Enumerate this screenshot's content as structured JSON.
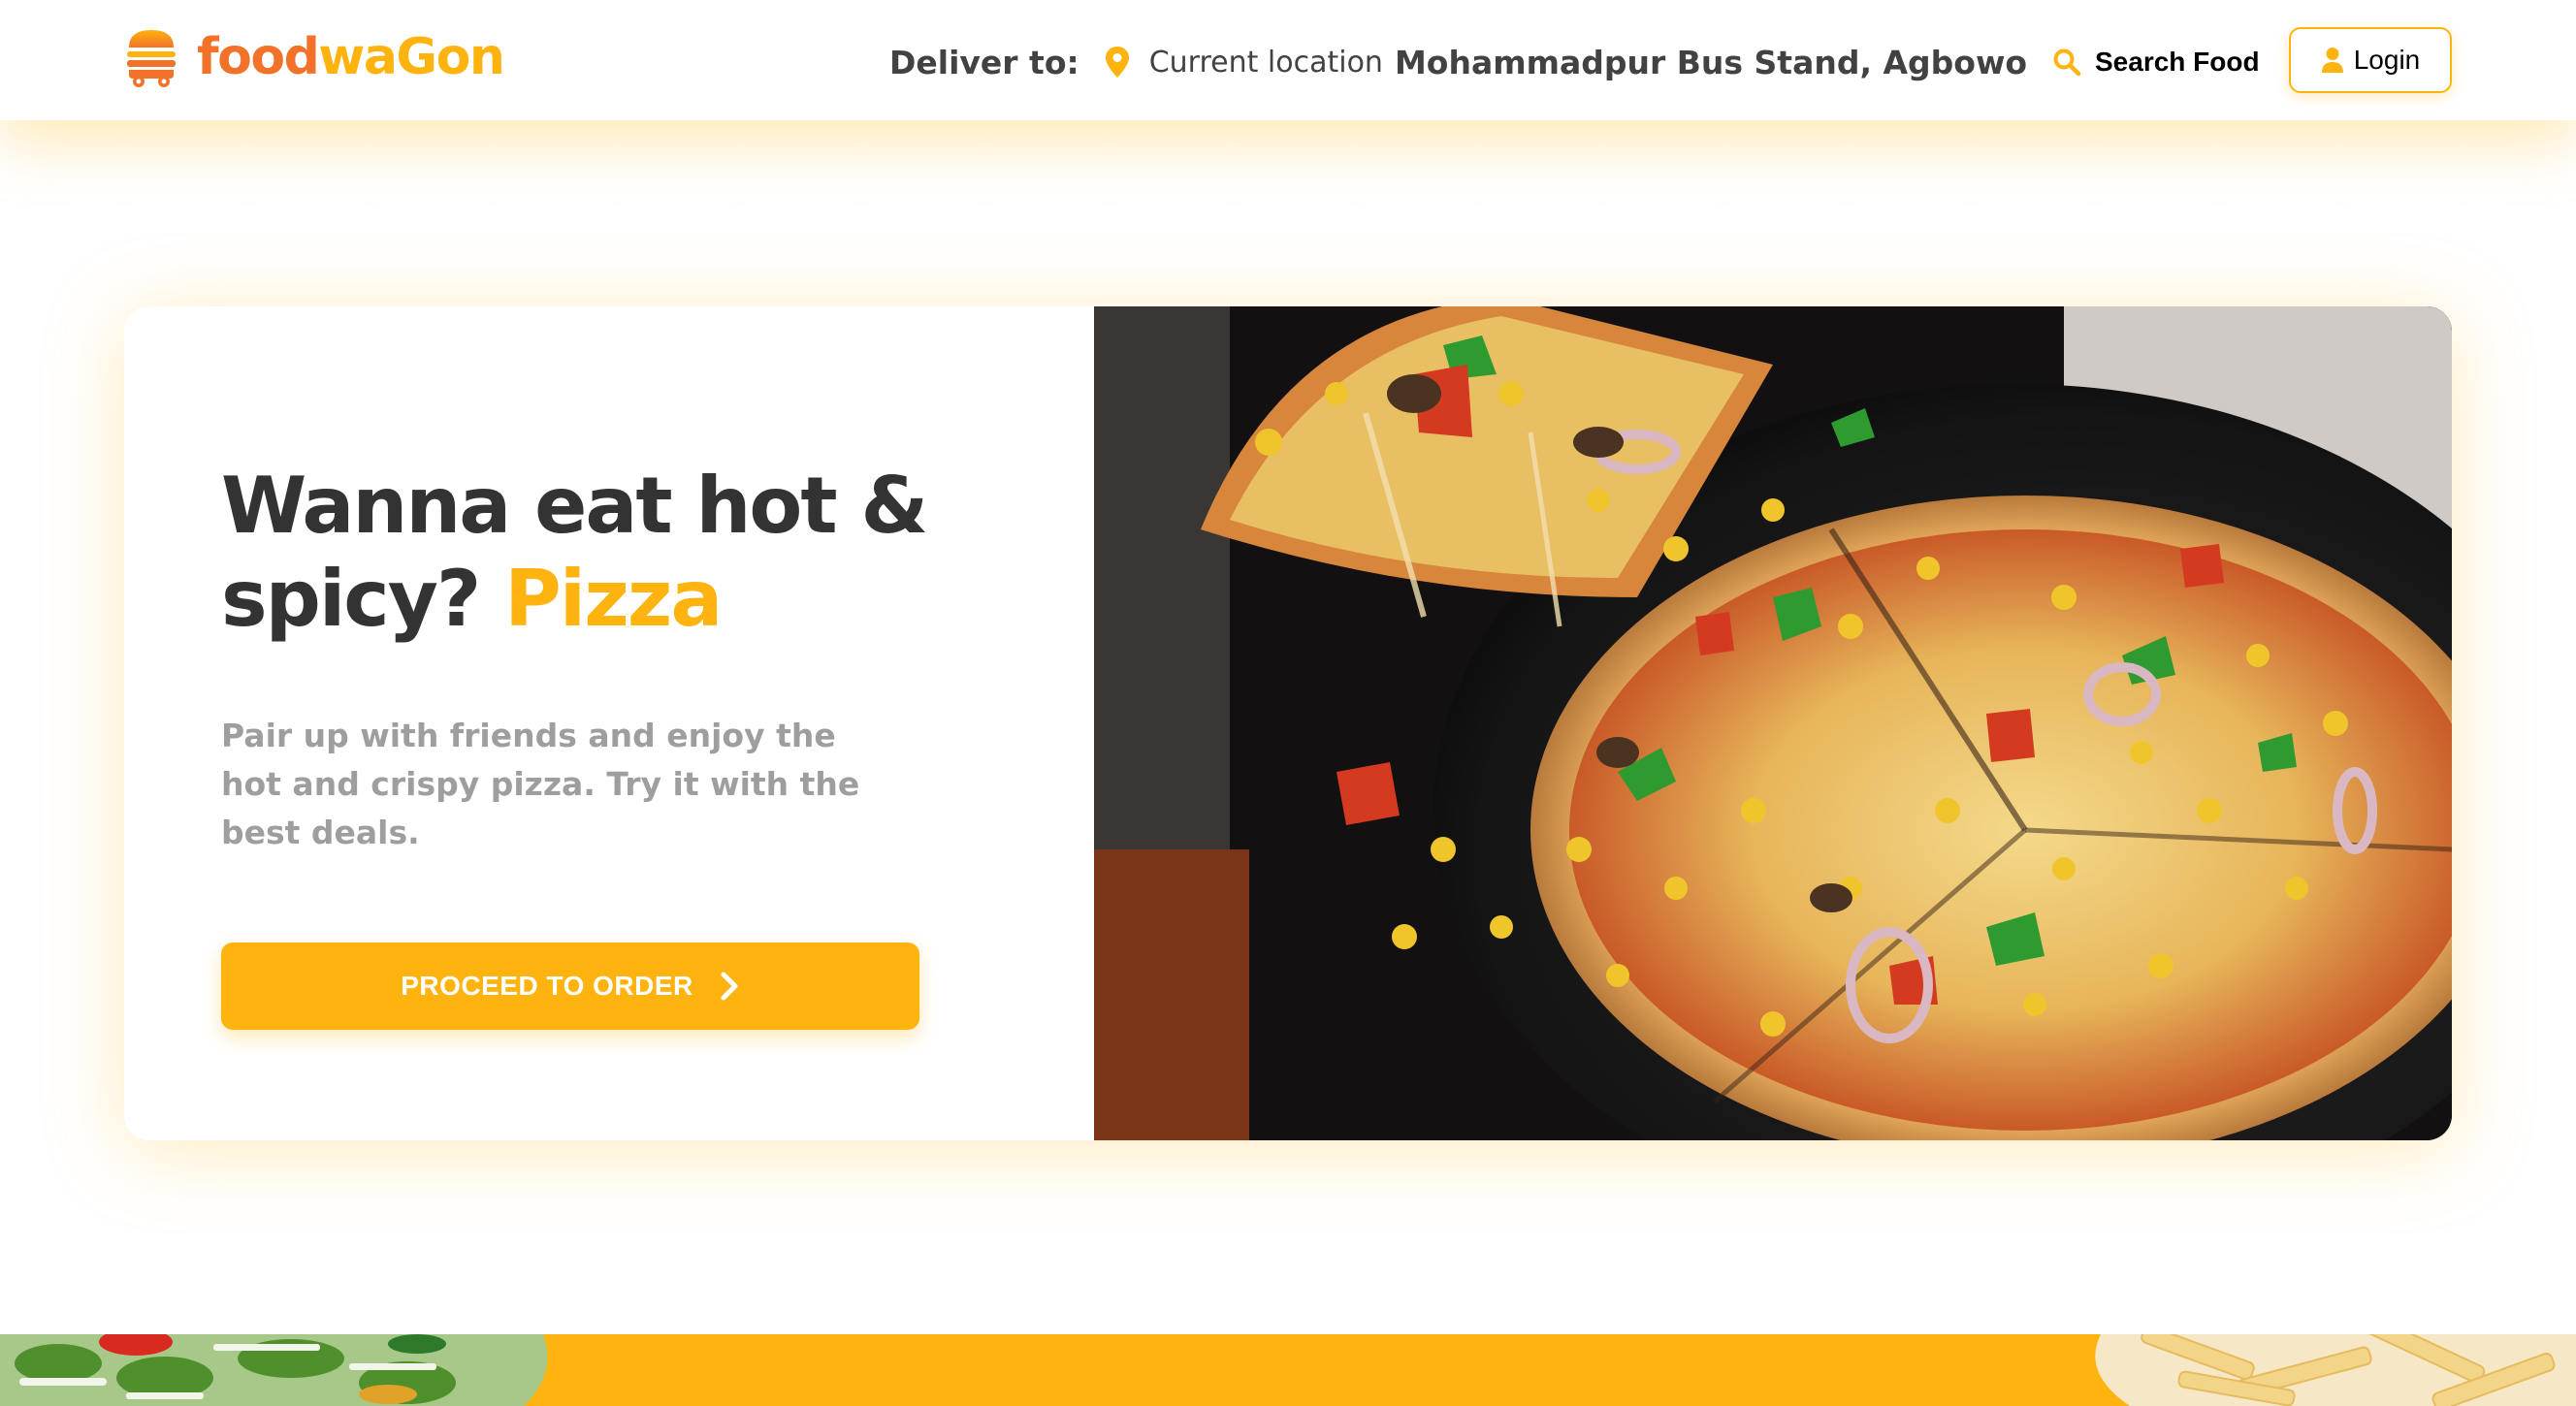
{
  "header": {
    "logo": {
      "part1": "food",
      "part2": "waGon",
      "icon": "burger-icon"
    },
    "deliver_label": "Deliver to:",
    "location_icon": "map-pin-icon",
    "current_location_label": "Current location",
    "address": "Mohammadpur Bus Stand, Agbowo",
    "search_icon": "search-icon",
    "search_label": "Search Food",
    "login_icon": "user-icon",
    "login_label": "Login"
  },
  "hero": {
    "title_main": "Wanna eat hot & spicy?",
    "title_accent": "Pizza",
    "description": "Pair up with friends and enjoy the hot and crispy pizza. Try it with the best deals.",
    "cta_label": "PROCEED TO ORDER",
    "cta_icon": "chevron-right-icon",
    "image": "pizza-photo"
  },
  "bottom_strip": {
    "left_image": "salad-photo",
    "right_image": "fries-photo"
  },
  "colors": {
    "brand_orange": "#f17228",
    "brand_yellow": "#ffb30e",
    "text_dark": "#424242",
    "text_muted": "#9e9e9e"
  }
}
